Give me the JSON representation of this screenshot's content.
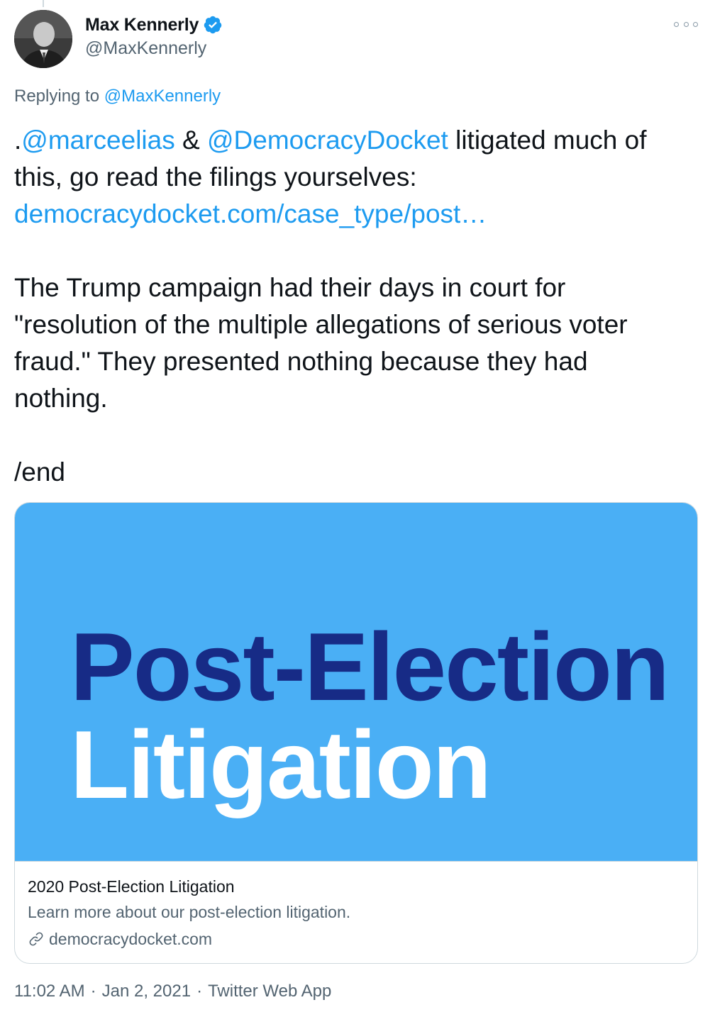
{
  "author": {
    "display_name": "Max Kennerly",
    "handle": "@MaxKennerly",
    "verified": true,
    "avatar_icon": "profile-photo"
  },
  "reply_context": {
    "prefix": "Replying to",
    "mention": "@MaxKennerly"
  },
  "tweet": {
    "lead": ".",
    "mention1": "@marceelias",
    "amp": " & ",
    "mention2": "@DemocracyDocket",
    "line1_rest": " litigated much of",
    "line2": "this, go read the filings yourselves:",
    "link": "democracydocket.com/case_type/post…",
    "para2_line1": "The Trump campaign had their days in court for",
    "para2_line2": "\"resolution of the multiple allegations of serious voter",
    "para2_line3": "fraud.\" They presented nothing because they had",
    "para2_line4": "nothing.",
    "end": "/end"
  },
  "card": {
    "image_line1": "Post-Election",
    "image_line2": "Litigation",
    "title": "2020 Post-Election Litigation",
    "description": "Learn more about our post-election litigation.",
    "domain": "democracydocket.com",
    "image_bg": "#4aaff5",
    "image_line1_color": "#172b86",
    "image_line2_color": "#ffffff"
  },
  "meta": {
    "time": "11:02 AM",
    "separator": "·",
    "date": "Jan 2, 2021",
    "source": "Twitter Web App"
  },
  "colors": {
    "accent": "#1d9bf0",
    "secondary_text": "#536471",
    "primary_text": "#0f1419",
    "border": "#cfd9de"
  }
}
